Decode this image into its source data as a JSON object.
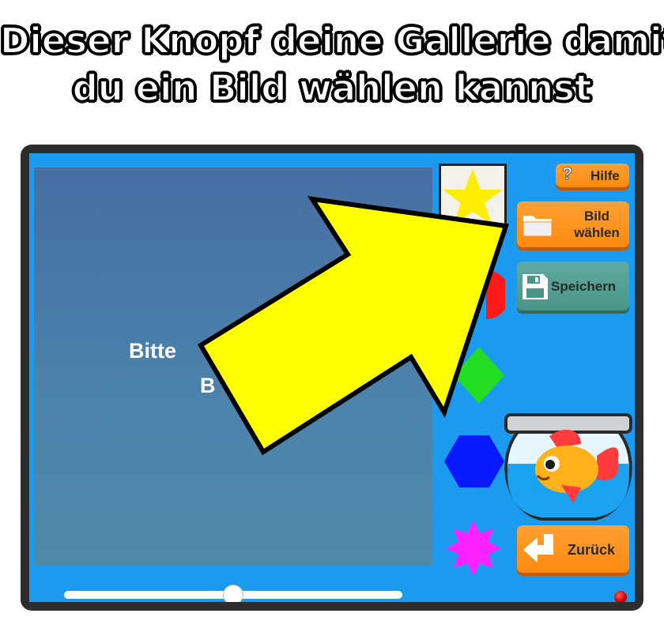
{
  "headline": {
    "line1": "Dieser Knopf deine Gallerie damit",
    "line2": "du ein Bild wählen kannst"
  },
  "canvas": {
    "message_line1": "Bitte",
    "message_line2": "B"
  },
  "toolbar": {
    "help_label": "Hilfe",
    "help_icon": "question-icon",
    "pick_image_label_line1": "Bild",
    "pick_image_label_line2": "wählen",
    "pick_image_icon": "folder-icon",
    "save_label": "Speichern",
    "save_icon": "floppy-disk-icon",
    "back_label": "Zurück",
    "back_icon": "return-arrow-icon"
  },
  "shapes": [
    {
      "name": "star",
      "color": "#ffee00"
    },
    {
      "name": "circle",
      "color": "#ff1a1a"
    },
    {
      "name": "diamond",
      "color": "#22dd22"
    },
    {
      "name": "hexagon",
      "color": "#0a1aff"
    },
    {
      "name": "burst",
      "color": "#ff22ff"
    }
  ],
  "slider": {
    "value_fraction": 0.5
  },
  "colors": {
    "screen_background": "#1b9bf0",
    "button_orange": "#ff8a10",
    "button_teal": "#4a9488",
    "arrow_fill": "#ffff00"
  }
}
